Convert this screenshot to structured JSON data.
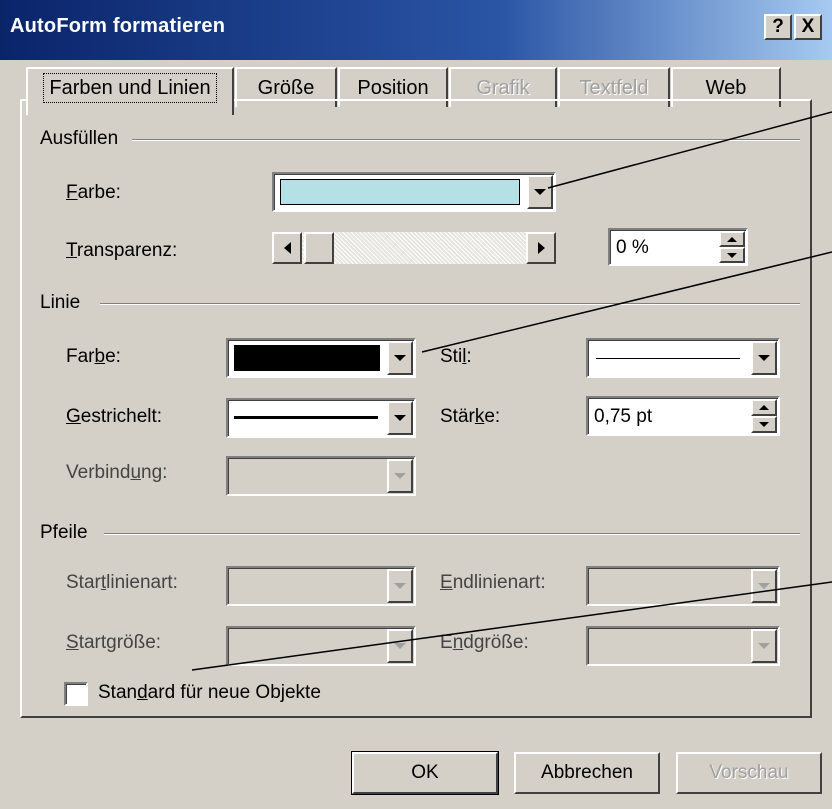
{
  "dialog": {
    "title": "AutoForm formatieren",
    "help_label": "?",
    "close_label": "X"
  },
  "tabs": [
    {
      "label": "Farben und Linien",
      "active": true
    },
    {
      "label": "Größe"
    },
    {
      "label": "Position"
    },
    {
      "label": "Grafik",
      "disabled": true
    },
    {
      "label": "Textfeld",
      "disabled": true
    },
    {
      "label": "Web"
    }
  ],
  "fill": {
    "group_label": "Ausfüllen",
    "color_label": {
      "mnemonic": "F",
      "rest": "arbe:"
    },
    "color_value": "#b5e0e6",
    "transparency_label": {
      "mnemonic": "T",
      "rest": "ransparenz:"
    },
    "transparency_value": "0 %",
    "transparency_level": 0
  },
  "line": {
    "group_label": "Linie",
    "color_label": {
      "pre": "Far",
      "mnemonic": "b",
      "rest": "e:"
    },
    "color_value": "#000000",
    "style_label": {
      "pre": "Sti",
      "mnemonic": "l",
      "rest": ":"
    },
    "dashed_label": {
      "mnemonic": "G",
      "rest": "estrichelt:"
    },
    "weight_label": {
      "pre": "Stär",
      "mnemonic": "k",
      "rest": "e:"
    },
    "weight_value": "0,75 pt",
    "join_label": {
      "pre": "Verbind",
      "mnemonic": "u",
      "rest": "ng:"
    }
  },
  "arrows": {
    "group_label": "Pfeile",
    "start_style_label": {
      "pre": "Star",
      "mnemonic": "t",
      "rest": "linienart:"
    },
    "end_style_label": {
      "mnemonic": "E",
      "rest": "ndlinienart:"
    },
    "start_size_label": {
      "mnemonic": "S",
      "rest": "tartgröße:"
    },
    "end_size_label": {
      "pre": "E",
      "mnemonic": "n",
      "rest": "dgröße:"
    }
  },
  "default_checkbox": {
    "label": {
      "pre": "Stan",
      "mnemonic": "d",
      "rest": "ard für neue Objekte"
    },
    "checked": false
  },
  "buttons": {
    "ok": "OK",
    "cancel": "Abbrechen",
    "preview": "Vorschau"
  },
  "colors": {
    "face": "#d4d0c8",
    "title_start": "#0a246a",
    "title_end": "#a6caf0",
    "fill_color": "#b5e0e6",
    "line_color": "#000000"
  }
}
